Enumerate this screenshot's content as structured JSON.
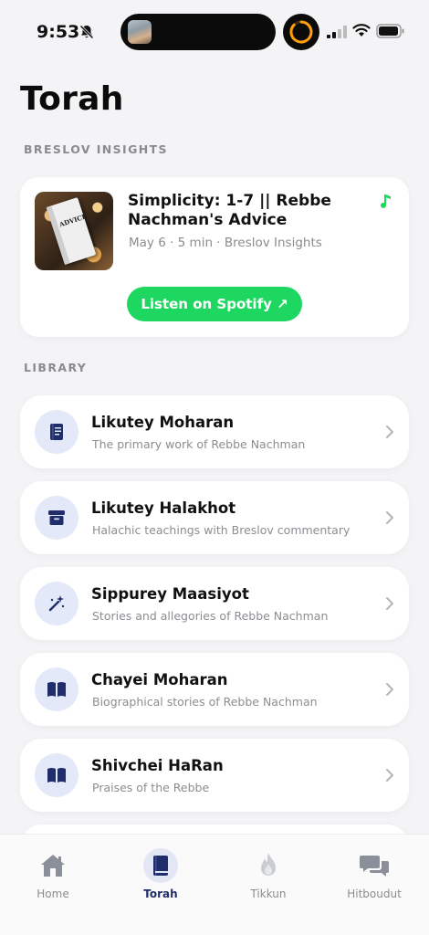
{
  "status_bar": {
    "time": "9:53"
  },
  "page_title": "Torah",
  "breslov_section_label": "BRESLOV INSIGHTS",
  "podcast": {
    "title": "Simplicity: 1-7 || Rebbe Nachman's Advice",
    "meta": "May 6 · 5 min · Breslov Insights",
    "cover_text": "ADVICE",
    "button_label": "Listen on Spotify ↗",
    "accent_color": "#1ed760"
  },
  "library_section_label": "LIBRARY",
  "library": [
    {
      "title": "Likutey Moharan",
      "subtitle": "The primary work of Rebbe Nachman",
      "icon": "book-icon"
    },
    {
      "title": "Likutey Halakhot",
      "subtitle": "Halachic teachings with Breslov commentary",
      "icon": "archive-icon"
    },
    {
      "title": "Sippurey Maasiyot",
      "subtitle": "Stories and allegories of Rebbe Nachman",
      "icon": "magic-wand-icon"
    },
    {
      "title": "Chayei Moharan",
      "subtitle": "Biographical stories of Rebbe Nachman",
      "icon": "open-book-icon"
    },
    {
      "title": "Shivchei HaRan",
      "subtitle": "Praises of the Rebbe",
      "icon": "open-book-icon"
    }
  ],
  "tabs": [
    {
      "label": "Home",
      "icon": "home-icon",
      "active": false
    },
    {
      "label": "Torah",
      "icon": "book-icon",
      "active": true
    },
    {
      "label": "Tikkun",
      "icon": "flame-icon",
      "active": false
    },
    {
      "label": "Hitboudut",
      "icon": "chat-bubbles-icon",
      "active": false
    }
  ],
  "colors": {
    "accent_navy": "#1f2d6b",
    "icon_bg": "#e3e9f9",
    "spotify_green": "#1ed760"
  }
}
